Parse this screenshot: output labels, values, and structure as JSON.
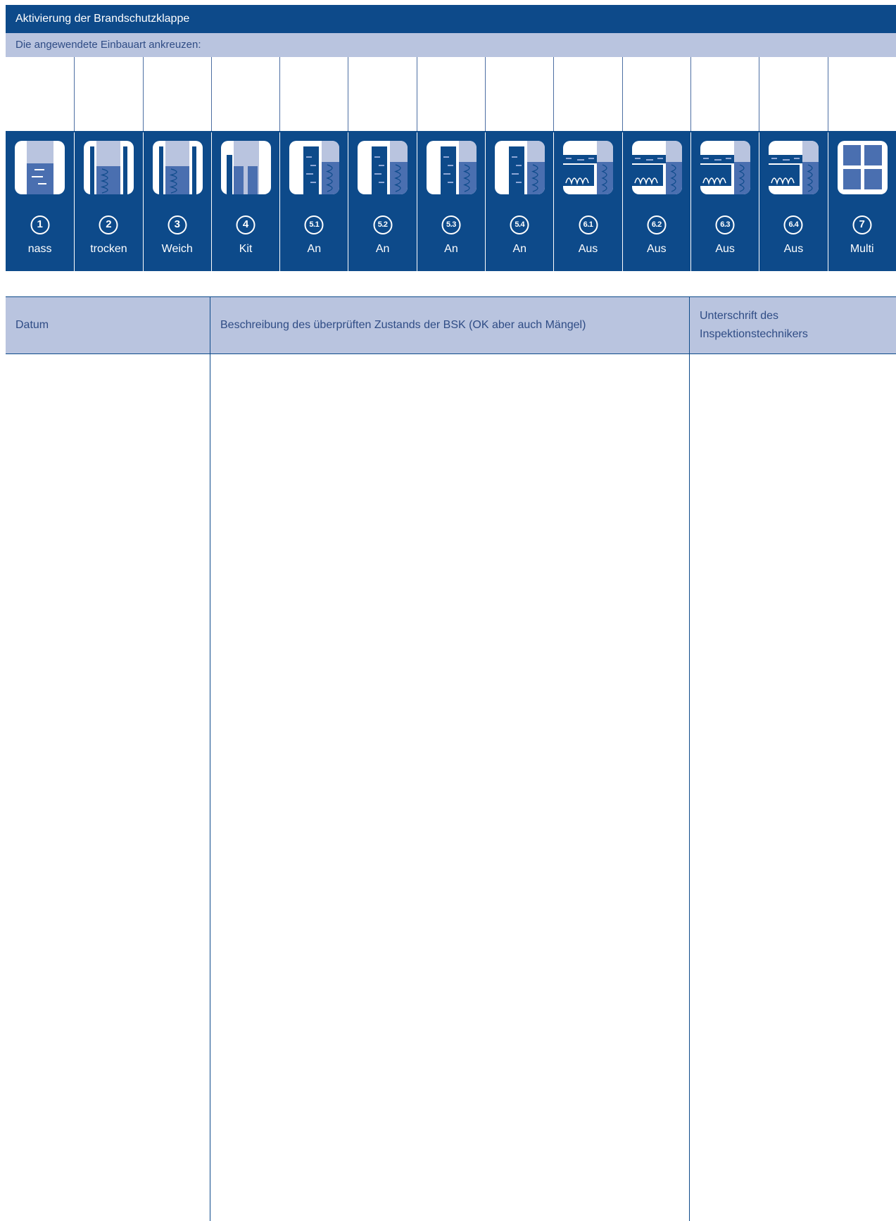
{
  "title": "Aktivierung der Brandschutzklappe",
  "instruction": "Die angewendete Einbauart ankreuzen:",
  "colors": {
    "primary": "#0d4a8a",
    "light": "#b9c4df",
    "icon_fill": "#4a6fb0",
    "icon_light": "#b9c4df"
  },
  "installation_types": [
    {
      "number": "1",
      "label": "nass",
      "icon": "wet-install-icon"
    },
    {
      "number": "2",
      "label": "trocken",
      "icon": "dry-install-icon"
    },
    {
      "number": "3",
      "label": "Weich",
      "icon": "soft-install-icon"
    },
    {
      "number": "4",
      "label": "Kit",
      "icon": "kit-install-icon"
    },
    {
      "number": "5.1",
      "label": "An",
      "icon": "wall-mounted-icon"
    },
    {
      "number": "5.2",
      "label": "An",
      "icon": "wall-mounted-icon"
    },
    {
      "number": "5.3",
      "label": "An",
      "icon": "wall-mounted-icon"
    },
    {
      "number": "5.4",
      "label": "An",
      "icon": "wall-mounted-icon"
    },
    {
      "number": "6.1",
      "label": "Aus",
      "icon": "ceiling-mounted-icon"
    },
    {
      "number": "6.2",
      "label": "Aus",
      "icon": "ceiling-mounted-icon"
    },
    {
      "number": "6.3",
      "label": "Aus",
      "icon": "ceiling-mounted-icon"
    },
    {
      "number": "6.4",
      "label": "Aus",
      "icon": "ceiling-mounted-icon"
    },
    {
      "number": "7",
      "label": "Multi",
      "icon": "multi-install-icon"
    }
  ],
  "table": {
    "headers": [
      "Datum",
      "Beschreibung des überprüften Zustands der BSK (OK aber auch Mängel)",
      "Unterschrift des Inspektionstechnikers"
    ]
  }
}
